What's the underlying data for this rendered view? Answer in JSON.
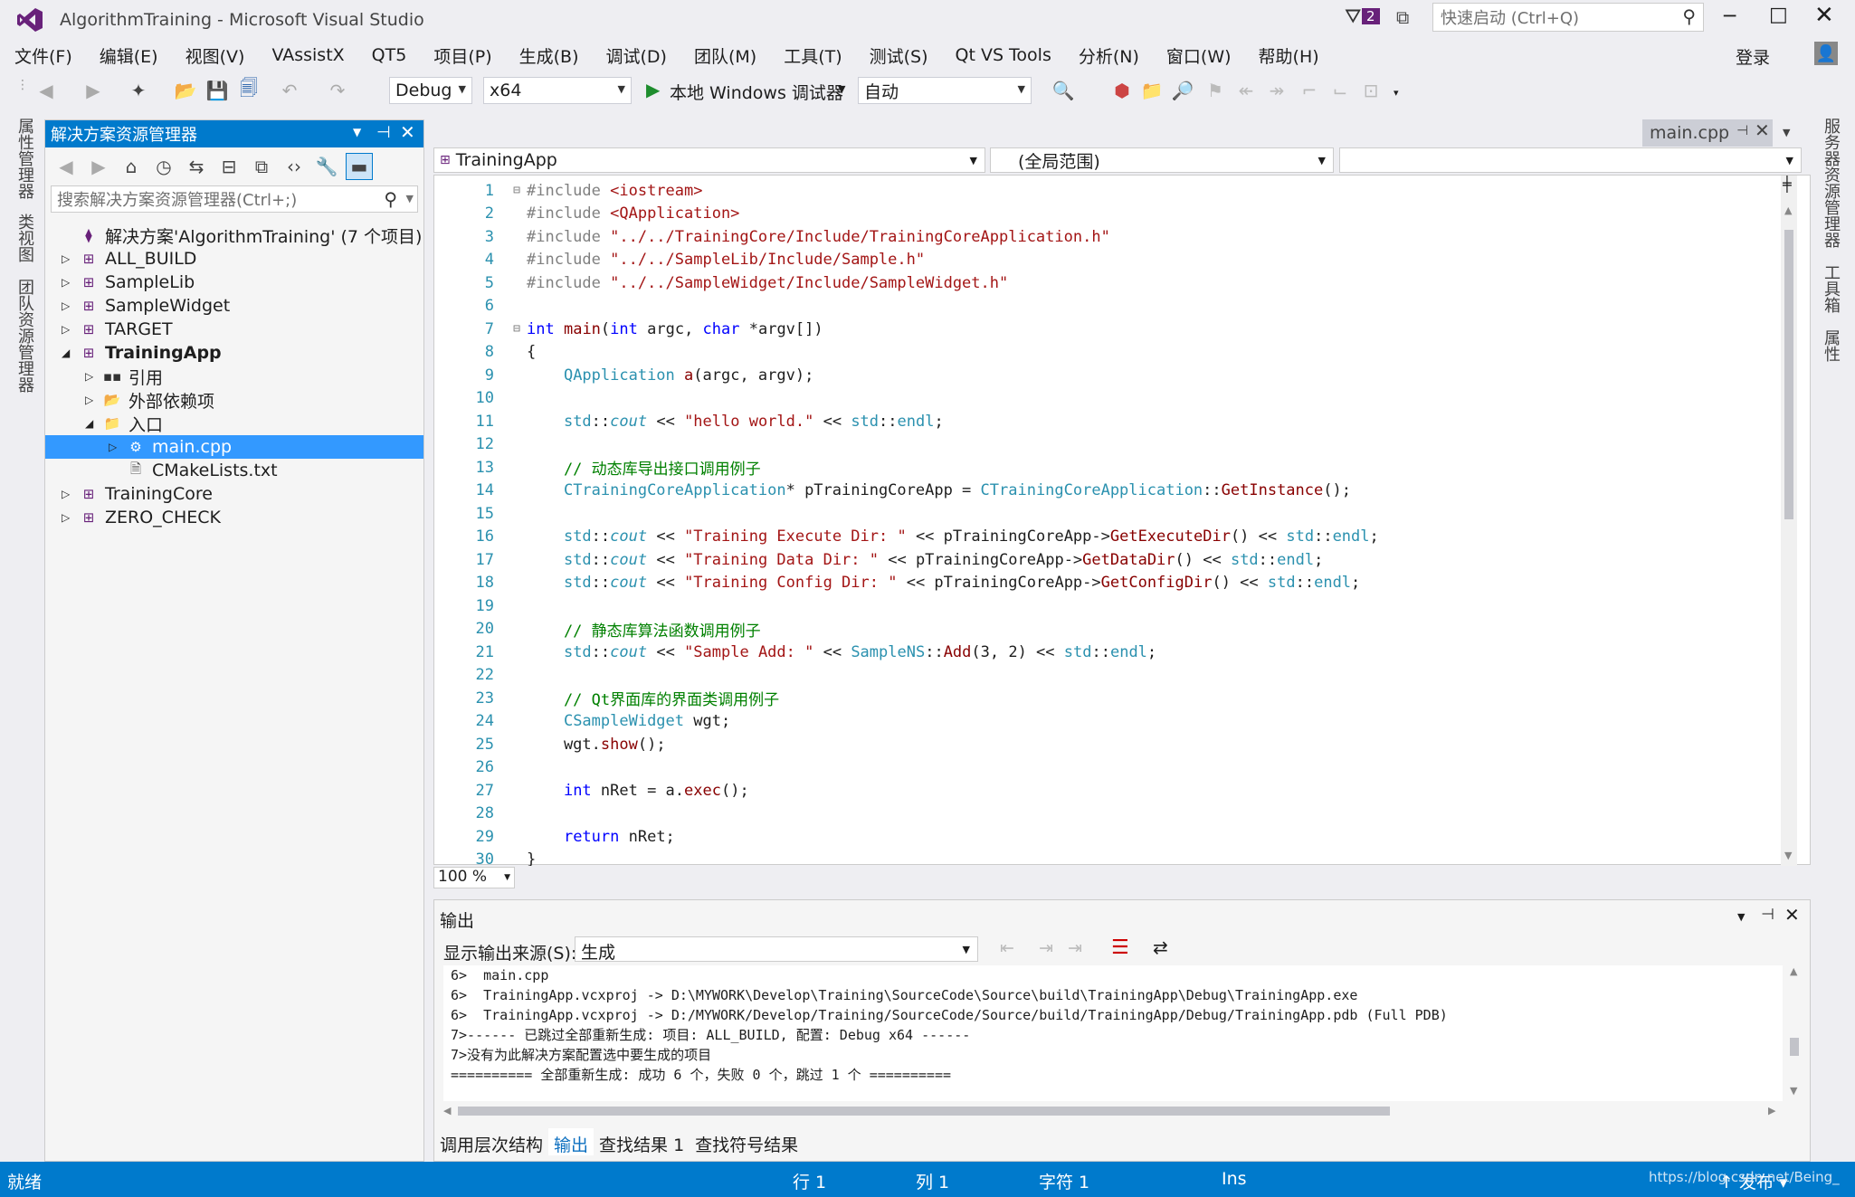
{
  "window": {
    "title": "AlgorithmTraining - Microsoft Visual Studio",
    "notif_count": "2",
    "quick_launch_placeholder": "快速启动 (Ctrl+Q)",
    "login": "登录"
  },
  "menu": [
    "文件(F)",
    "编辑(E)",
    "视图(V)",
    "VAssistX",
    "QT5",
    "项目(P)",
    "生成(B)",
    "调试(D)",
    "团队(M)",
    "工具(T)",
    "测试(S)",
    "Qt VS Tools",
    "分析(N)",
    "窗口(W)",
    "帮助(H)"
  ],
  "toolbar": {
    "config": "Debug",
    "platform": "x64",
    "debugger": "本地 Windows 调试器",
    "auto": "自动"
  },
  "left_tabs": [
    "属性管理器",
    "类视图",
    "团队资源管理器"
  ],
  "right_tabs": [
    "服务器资源管理器",
    "工具箱",
    "属性"
  ],
  "solution_explorer": {
    "title": "解决方案资源管理器",
    "search_placeholder": "搜索解决方案资源管理器(Ctrl+;)",
    "tree": [
      {
        "label": "解决方案'AlgorithmTraining' (7 个项目)",
        "indent": 0,
        "expander": "",
        "icon": "solution-icon"
      },
      {
        "label": "ALL_BUILD",
        "indent": 0,
        "expander": "▷",
        "icon": "project-icon"
      },
      {
        "label": "SampleLib",
        "indent": 0,
        "expander": "▷",
        "icon": "project-icon"
      },
      {
        "label": "SampleWidget",
        "indent": 0,
        "expander": "▷",
        "icon": "project-icon"
      },
      {
        "label": "TARGET",
        "indent": 0,
        "expander": "▷",
        "icon": "project-icon"
      },
      {
        "label": "TrainingApp",
        "indent": 0,
        "expander": "◢",
        "icon": "project-icon",
        "bold": true
      },
      {
        "label": "引用",
        "indent": 1,
        "expander": "▷",
        "icon": "references-icon"
      },
      {
        "label": "外部依赖项",
        "indent": 1,
        "expander": "▷",
        "icon": "external-deps-icon"
      },
      {
        "label": "入口",
        "indent": 1,
        "expander": "◢",
        "icon": "folder-icon"
      },
      {
        "label": "main.cpp",
        "indent": 2,
        "expander": "▷",
        "icon": "cpp-file-icon",
        "selected": true
      },
      {
        "label": "CMakeLists.txt",
        "indent": 2,
        "expander": "",
        "icon": "text-file-icon"
      },
      {
        "label": "TrainingCore",
        "indent": 0,
        "expander": "▷",
        "icon": "project-icon"
      },
      {
        "label": "ZERO_CHECK",
        "indent": 0,
        "expander": "▷",
        "icon": "project-icon"
      }
    ]
  },
  "editor": {
    "tab": "main.cpp",
    "project_combo": "TrainingApp",
    "scope_combo": "(全局范围)",
    "zoom": "100 %",
    "lines": [
      "#include <iostream>",
      "#include <QApplication>",
      "#include \"../../TrainingCore/Include/TrainingCoreApplication.h\"",
      "#include \"../../SampleLib/Include/Sample.h\"",
      "#include \"../../SampleWidget/Include/SampleWidget.h\"",
      "",
      "int main(int argc, char *argv[])",
      "{",
      "    QApplication a(argc, argv);",
      "",
      "    std::cout << \"hello world.\" << std::endl;",
      "",
      "    // 动态库导出接口调用例子",
      "    CTrainingCoreApplication* pTrainingCoreApp = CTrainingCoreApplication::GetInstance();",
      "",
      "    std::cout << \"Training Execute Dir: \" << pTrainingCoreApp->GetExecuteDir() << std::endl;",
      "    std::cout << \"Training Data Dir: \" << pTrainingCoreApp->GetDataDir() << std::endl;",
      "    std::cout << \"Training Config Dir: \" << pTrainingCoreApp->GetConfigDir() << std::endl;",
      "",
      "    // 静态库算法函数调用例子",
      "    std::cout << \"Sample Add: \" << SampleNS::Add(3, 2) << std::endl;",
      "",
      "    // Qt界面库的界面类调用例子",
      "    CSampleWidget wgt;",
      "    wgt.show();",
      "",
      "    int nRet = a.exec();",
      "",
      "    return nRet;",
      "}"
    ]
  },
  "output": {
    "title": "输出",
    "source_label": "显示输出来源(S):",
    "source_value": "生成",
    "lines": [
      "6>  main.cpp",
      "6>  TrainingApp.vcxproj -> D:\\MYWORK\\Develop\\Training\\SourceCode\\Source\\build\\TrainingApp\\Debug\\TrainingApp.exe",
      "6>  TrainingApp.vcxproj -> D:/MYWORK/Develop/Training/SourceCode/Source/build/TrainingApp/Debug/TrainingApp.pdb (Full PDB)",
      "7>------ 已跳过全部重新生成: 项目: ALL_BUILD, 配置: Debug x64 ------",
      "7>没有为此解决方案配置选中要生成的项目",
      "========== 全部重新生成: 成功 6 个，失败 0 个，跳过 1 个 =========="
    ],
    "tabs": [
      "调用层次结构",
      "输出",
      "查找结果 1",
      "查找符号结果"
    ]
  },
  "status": {
    "ready": "就绪",
    "row": "行 1",
    "col": "列 1",
    "char": "字符 1",
    "ins": "Ins",
    "publish": "↑ 发布 ▾",
    "watermark": "https://blog.csdn.net/Being_"
  },
  "colors": {
    "accent": "#007acc",
    "keyword": "#0000ff",
    "string": "#a31515",
    "comment": "#008000",
    "type": "#2b91af"
  }
}
